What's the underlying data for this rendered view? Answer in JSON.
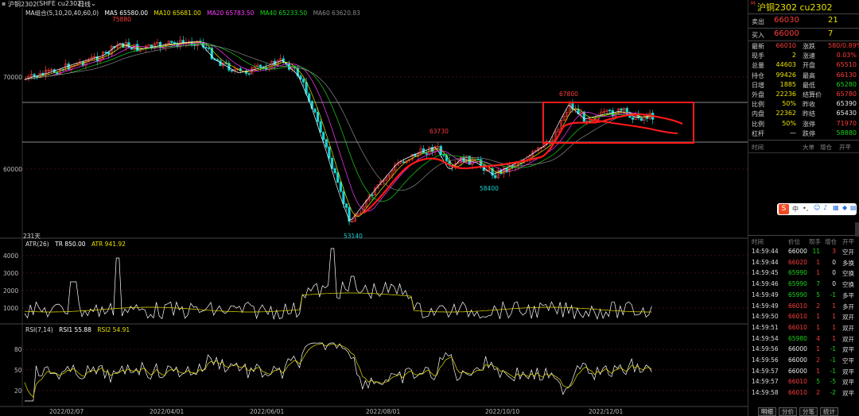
{
  "title": {
    "symbol": "沪铜2302",
    "market": "(SHFE cu2302)",
    "period": "日线"
  },
  "ma_line": {
    "label": "MA组合(5,10,20,40,60,0)",
    "ma5": "MA5 65580.00",
    "ma10": "MA10 65681.00",
    "ma20": "MA20 65783.50",
    "ma40": "MA40 65233.50",
    "ma60": "MA60 63620.83"
  },
  "atr_line": {
    "label": "ATR(26)",
    "tr": "TR 850.00",
    "atr": "ATR 941.92"
  },
  "rsi_line": {
    "label": "RSI(7,14)",
    "rsi1": "RSI1 55.88",
    "rsi2": "RSI2 54.91"
  },
  "price_axis": {
    "t1": "70000",
    "t2": "60000"
  },
  "atr_axis": {
    "t1": "4000",
    "t2": "3000",
    "t3": "2000",
    "t4": "1000"
  },
  "rsi_axis": {
    "t1": "80",
    "t2": "50",
    "t3": "20"
  },
  "x_axis": [
    "2022/02/07",
    "2022/04/01",
    "2022/06/01",
    "2022/08/01",
    "2022/10/10",
    "2022/12/01"
  ],
  "annotations": {
    "high1": "75880",
    "low1": "53140",
    "high2": "63730",
    "low2": "58400",
    "high3": "67800",
    "left_count": "231天"
  },
  "quote": {
    "header": "沪铜2302 cu2302",
    "sell_label": "卖出",
    "sell_price": "66030",
    "sell_vol": "21",
    "buy_label": "买入",
    "buy_price": "66000",
    "buy_vol": "7",
    "rows": [
      {
        "l1": "最新",
        "v1": "66010",
        "l2": "涨跌",
        "v2": "580/0.89%"
      },
      {
        "l1": "现手",
        "v1": "2",
        "l2": "涨速",
        "v2": "0.03%"
      },
      {
        "l1": "总量",
        "v1": "44603",
        "l2": "开盘",
        "v2": "65510"
      },
      {
        "l1": "持仓",
        "v1": "99426",
        "l2": "最高",
        "v2": "66130"
      },
      {
        "l1": "日增",
        "v1": "1885",
        "l2": "最低",
        "v2": "65280"
      },
      {
        "l1": "外盘",
        "v1": "22236",
        "l2": "结算价",
        "v2": "65780"
      },
      {
        "l1": "比例",
        "v1": "50%",
        "l2": "昨收",
        "v2": "65390"
      },
      {
        "l1": "内盘",
        "v1": "22362",
        "l2": "昨结",
        "v2": "65430"
      },
      {
        "l1": "比例",
        "v1": "50%",
        "l2": "涨停",
        "v2": "71970"
      },
      {
        "l1": "杠杆",
        "v1": "—",
        "l2": "跌停",
        "v2": "58880"
      }
    ],
    "table1_header": [
      "时间",
      "大单",
      "增仓",
      "开平"
    ],
    "table2_header": [
      "时间",
      "价位",
      "现手",
      "增仓",
      "开平"
    ],
    "trades": [
      {
        "t": "14:59:44",
        "p": "66000",
        "q": "11",
        "z": "3",
        "k": "空开"
      },
      {
        "t": "14:59:44",
        "p": "66020",
        "q": "1",
        "z": "0",
        "k": "多换"
      },
      {
        "t": "14:59:45",
        "p": "65990",
        "q": "1",
        "z": "0",
        "k": "空换"
      },
      {
        "t": "14:59:46",
        "p": "65990",
        "q": "7",
        "z": "0",
        "k": "空换"
      },
      {
        "t": "14:59:49",
        "p": "65990",
        "q": "5",
        "z": "-1",
        "k": "多平"
      },
      {
        "t": "14:59:49",
        "p": "66010",
        "q": "2",
        "z": "1",
        "k": "多开"
      },
      {
        "t": "14:59:50",
        "p": "66010",
        "q": "1",
        "z": "1",
        "k": "双开"
      },
      {
        "t": "14:59:51",
        "p": "66010",
        "q": "1",
        "z": "1",
        "k": "双开"
      },
      {
        "t": "14:59:54",
        "p": "65980",
        "q": "4",
        "z": "1",
        "k": "双开"
      },
      {
        "t": "14:59:56",
        "p": "66000",
        "q": "1",
        "z": "-1",
        "k": "双平"
      },
      {
        "t": "14:59:56",
        "p": "66000",
        "q": "2",
        "z": "-1",
        "k": "空平"
      },
      {
        "t": "14:59:57",
        "p": "66000",
        "q": "1",
        "z": "-1",
        "k": "双平"
      },
      {
        "t": "14:59:57",
        "p": "66010",
        "q": "5",
        "z": "-5",
        "k": "双平"
      },
      {
        "t": "14:59:58",
        "p": "66010",
        "q": "2",
        "z": "-2",
        "k": "双平"
      }
    ],
    "tabs": [
      "明细",
      "分价",
      "分笔",
      "统计"
    ]
  },
  "colors": {
    "up": "#ff3b3b",
    "down": "#19d4d4",
    "box": "#ff1a1a"
  }
}
